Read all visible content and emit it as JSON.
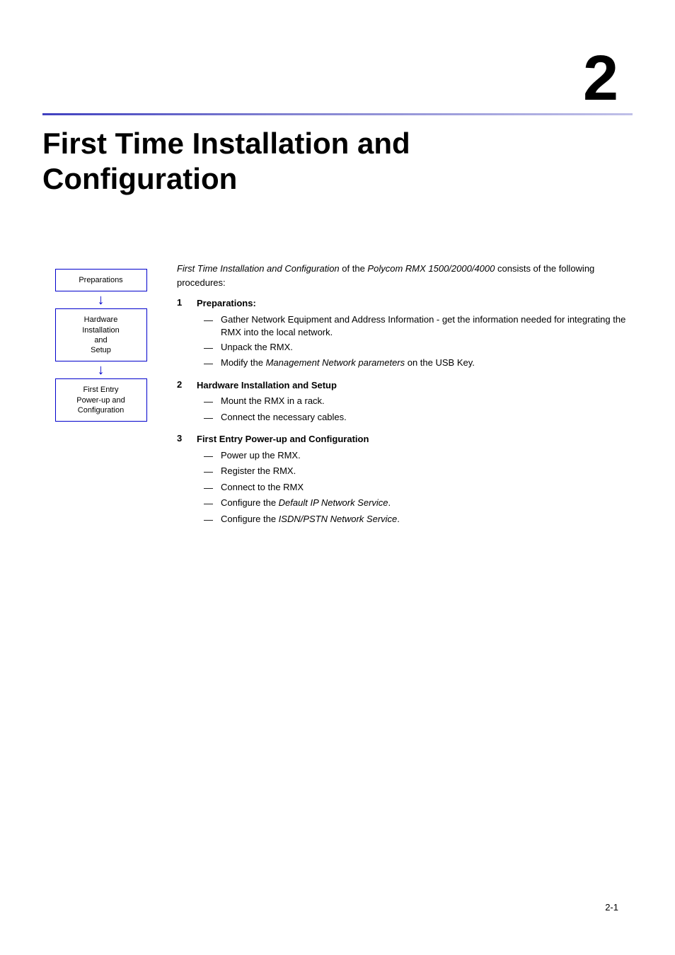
{
  "chapter": {
    "number": "2",
    "title": "First Time Installation and\nConfiguration",
    "page_number": "2-1"
  },
  "intro": {
    "italic_part": "First Time Installation and Configuration",
    "text1": " of the ",
    "italic_part2": "Polycom RMX 1500/2000/4000",
    "text2": " consists of the following procedures:"
  },
  "diagram": {
    "box1": "Preparations",
    "box2_line1": "Hardware",
    "box2_line2": "Installation",
    "box2_line3": "and",
    "box2_line4": "Setup",
    "box3_line1": "First Entry",
    "box3_line2": "Power-up and",
    "box3_line3": "Configuration"
  },
  "procedures": [
    {
      "number": "1",
      "header": "Preparations:",
      "bullets": [
        {
          "text": "Gather Network Equipment and Address Information - get the information needed for integrating the RMX into the local network.",
          "italic": false
        },
        {
          "text": "Unpack the RMX.",
          "italic": false
        },
        {
          "text_pre": "Modify the ",
          "text_italic": "Management Network parameters",
          "text_post": " on the USB Key.",
          "mixed": true
        }
      ]
    },
    {
      "number": "2",
      "header": "Hardware Installation and Setup",
      "bullets": [
        {
          "text": "Mount the RMX in a rack.",
          "italic": false
        },
        {
          "text": "Connect the necessary cables.",
          "italic": false
        }
      ]
    },
    {
      "number": "3",
      "header": "First Entry Power-up and Configuration",
      "bullets": [
        {
          "text": "Power up the RMX.",
          "italic": false
        },
        {
          "text": "Register the RMX.",
          "italic": false
        },
        {
          "text": "Connect to the RMX",
          "italic": false
        },
        {
          "text_pre": "Configure the ",
          "text_italic": "Default IP Network Service",
          "text_post": ".",
          "mixed": true
        },
        {
          "text_pre": "Configure the ",
          "text_italic": "ISDN/PSTN Network Service",
          "text_post": ".",
          "mixed": true
        }
      ]
    }
  ]
}
